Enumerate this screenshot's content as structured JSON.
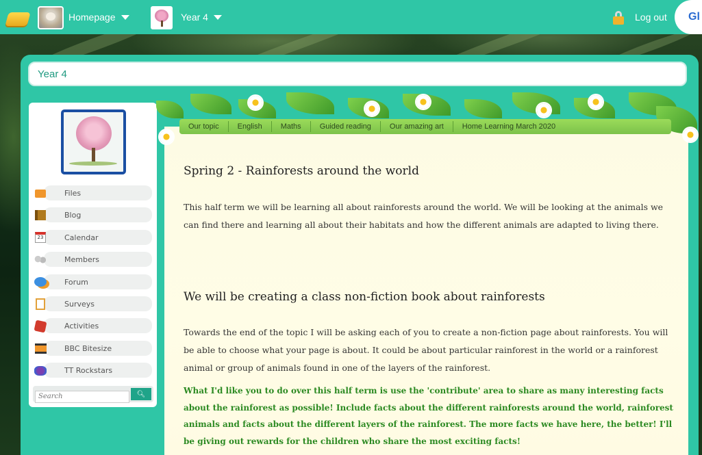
{
  "topbar": {
    "homepage_label": "Homepage",
    "year_label": "Year 4",
    "logout_label": "Log out",
    "brand_fragment": "Gl"
  },
  "page_title": "Year 4",
  "sidebar": {
    "items": [
      {
        "label": "Files",
        "icon": "folder-icon"
      },
      {
        "label": "Blog",
        "icon": "book-icon"
      },
      {
        "label": "Calendar",
        "icon": "calendar-icon"
      },
      {
        "label": "Members",
        "icon": "members-icon"
      },
      {
        "label": "Forum",
        "icon": "forum-icon"
      },
      {
        "label": "Surveys",
        "icon": "clipboard-icon"
      },
      {
        "label": "Activities",
        "icon": "activities-icon"
      },
      {
        "label": "BBC Bitesize",
        "icon": "bbc-icon"
      },
      {
        "label": "TT Rockstars",
        "icon": "rockstar-icon"
      }
    ],
    "calendar_number": "23",
    "search_placeholder": "Search"
  },
  "nav_tabs": [
    "Our topic",
    "English",
    "Maths",
    "Guided reading",
    "Our amazing art",
    "Home Learning March 2020"
  ],
  "content": {
    "heading1": "Spring 2 - Rainforests around the world",
    "para1": "This half term we will be learning all about rainforests around the world. We will be looking at the animals we can find there and learning all about their habitats and how the different animals are adapted to living there.",
    "heading2": "We will be creating a class non-fiction book about rainforests",
    "para2": "Towards the end of the topic I will be asking each of you to create a non-fiction page about rainforests. You will be able to choose what your page is about. It could be about particular rainforest in the world or a rainforest animal or group of animals found in one of the layers of the rainforest.",
    "para3": "What I'd like you to do over this half term is use the 'contribute' area to share as many interesting facts about the rainforest as possible! Include facts about the different rainforests around the world, rainforest animals and facts about the different layers of the rainforest. The more facts we have here, the better! I'll be giving out rewards for the children who share the most exciting facts!"
  },
  "colors": {
    "teal": "#2fc6a6",
    "title_text": "#1f9a80",
    "green_text": "#2c8a22"
  }
}
